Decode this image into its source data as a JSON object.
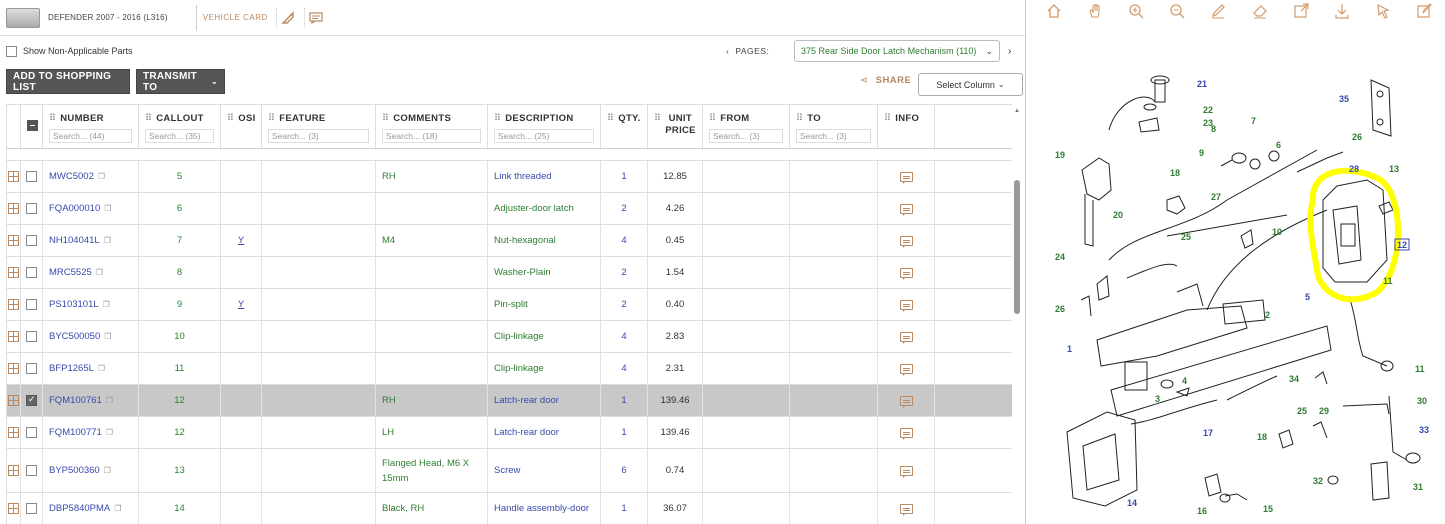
{
  "header": {
    "vehicle_title": "DEFENDER 2007 - 2016 (L316)",
    "vehicle_card_label": "VEHICLE CARD"
  },
  "filters": {
    "show_non_applicable_label": "Show Non-Applicable Parts",
    "pages_label": "PAGES:",
    "pages_selected": "375 Rear Side Door Latch Mechanism (110)"
  },
  "actions": {
    "add_to_shopping_list": "ADD TO SHOPPING LIST",
    "transmit_to": "TRANSMIT TO",
    "share": "SHARE",
    "select_column": "Select Column"
  },
  "table": {
    "columns": [
      {
        "key": "number",
        "label": "NUMBER",
        "search": "Search... (44)"
      },
      {
        "key": "callout",
        "label": "CALLOUT",
        "search": "Search... (35)"
      },
      {
        "key": "osi",
        "label": "OSI",
        "search": ""
      },
      {
        "key": "feature",
        "label": "FEATURE",
        "search": "Search... (3)"
      },
      {
        "key": "comments",
        "label": "COMMENTS",
        "search": "Search... (18)"
      },
      {
        "key": "description",
        "label": "DESCRIPTION",
        "search": "Search... (25)"
      },
      {
        "key": "qty",
        "label": "QTY.",
        "search": ""
      },
      {
        "key": "unit_price",
        "label": "UNIT PRICE",
        "search": ""
      },
      {
        "key": "from",
        "label": "FROM",
        "search": "Search... (3)"
      },
      {
        "key": "to",
        "label": "TO",
        "search": "Search... (3)"
      },
      {
        "key": "info",
        "label": "INFO",
        "search": ""
      }
    ],
    "rows": [
      {
        "number": "MWC5002",
        "callout": "5",
        "osi": "",
        "feature": "",
        "comments": "RH",
        "description": "Link threaded",
        "qty": "1",
        "unit_price": "12.85",
        "selected": false
      },
      {
        "number": "FQA000010",
        "callout": "6",
        "osi": "",
        "feature": "",
        "comments": "",
        "description": "Adjuster-door latch",
        "qty": "2",
        "unit_price": "4.26",
        "selected": false
      },
      {
        "number": "NH104041L",
        "callout": "7",
        "osi": "Y",
        "feature": "",
        "comments": "M4",
        "description": "Nut-hexagonal",
        "qty": "4",
        "unit_price": "0.45",
        "selected": false
      },
      {
        "number": "MRC5525",
        "callout": "8",
        "osi": "",
        "feature": "",
        "comments": "",
        "description": "Washer-Plain",
        "qty": "2",
        "unit_price": "1.54",
        "selected": false
      },
      {
        "number": "PS103101L",
        "callout": "9",
        "osi": "Y",
        "feature": "",
        "comments": "",
        "description": "Pin-split",
        "qty": "2",
        "unit_price": "0.40",
        "selected": false
      },
      {
        "number": "BYC500050",
        "callout": "10",
        "osi": "",
        "feature": "",
        "comments": "",
        "description": "Clip-linkage",
        "qty": "4",
        "unit_price": "2.83",
        "selected": false
      },
      {
        "number": "BFP1265L",
        "callout": "11",
        "osi": "",
        "feature": "",
        "comments": "",
        "description": "Clip-linkage",
        "qty": "4",
        "unit_price": "2.31",
        "selected": false
      },
      {
        "number": "FQM100761",
        "callout": "12",
        "osi": "",
        "feature": "",
        "comments": "RH",
        "description": "Latch-rear door",
        "qty": "1",
        "unit_price": "139.46",
        "selected": true
      },
      {
        "number": "FQM100771",
        "callout": "12",
        "osi": "",
        "feature": "",
        "comments": "LH",
        "description": "Latch-rear door",
        "qty": "1",
        "unit_price": "139.46",
        "selected": false
      },
      {
        "number": "BYP500360",
        "callout": "13",
        "osi": "",
        "feature": "",
        "comments": "Flanged Head, M6 X 15mm",
        "description": "Screw",
        "qty": "6",
        "unit_price": "0.74",
        "selected": false
      },
      {
        "number": "DBP5840PMA",
        "callout": "14",
        "osi": "",
        "feature": "",
        "comments": "Black, RH",
        "description": "Handle assembly-door",
        "qty": "1",
        "unit_price": "36.07",
        "selected": false
      }
    ]
  },
  "diagram": {
    "callouts": [
      "21",
      "22",
      "23",
      "35",
      "8",
      "7",
      "6",
      "26",
      "9",
      "19",
      "28",
      "13",
      "18",
      "27",
      "20",
      "10",
      "25",
      "24",
      "12",
      "5",
      "11",
      "26",
      "2",
      "1",
      "4",
      "3",
      "34",
      "11",
      "25",
      "29",
      "30",
      "17",
      "18",
      "33",
      "14",
      "32",
      "31",
      "16",
      "15"
    ],
    "highlighted_callout": "12",
    "highlight_color": "#ffff00"
  },
  "colors": {
    "accent": "#b88a62",
    "link_blue": "#3949ab",
    "text_green": "#2e7d32",
    "selected_row": "#c8c8c8"
  },
  "icons": [
    "home-icon",
    "pan-hand-icon",
    "zoom-in-icon",
    "zoom-out-icon",
    "pen-icon",
    "eraser-icon",
    "open-external-icon",
    "download-icon",
    "pointer-icon",
    "edit-icon"
  ]
}
